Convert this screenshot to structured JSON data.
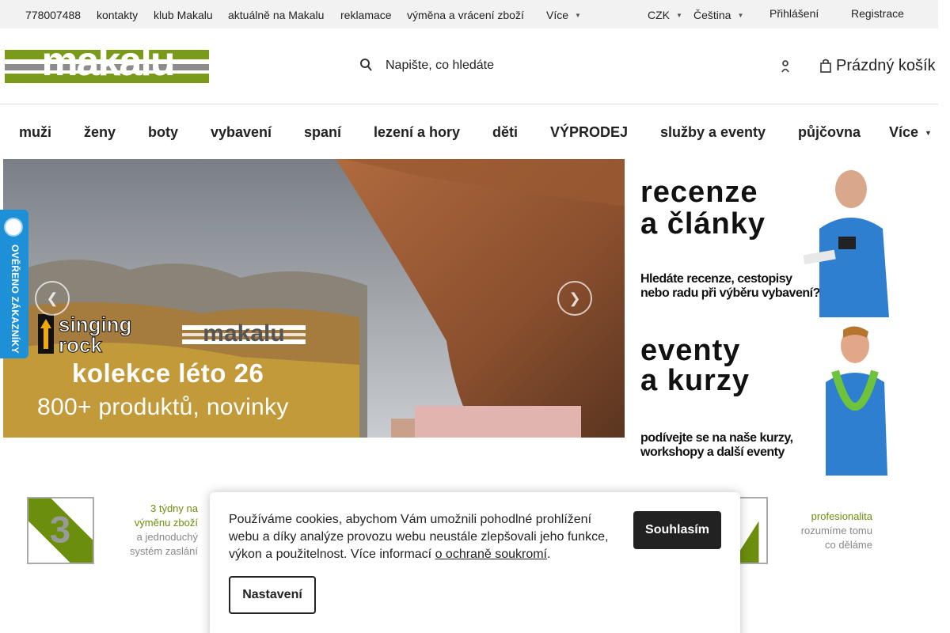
{
  "topbar": {
    "phone": "778007488",
    "links": [
      "kontakty",
      "klub Makalu",
      "aktuálně na Makalu",
      "reklamace",
      "výměna a vrácení zboží"
    ],
    "more": "Více",
    "currency": "CZK",
    "language": "Čeština",
    "login": "Přihlášení",
    "register": "Registrace"
  },
  "header": {
    "logo_text": "makalu",
    "search_placeholder": "Napište, co hledáte",
    "cart_label": "Prázdný košík"
  },
  "nav": {
    "items": [
      "muži",
      "ženy",
      "boty",
      "vybavení",
      "spaní",
      "lezení a hory",
      "děti",
      "VÝPRODEJ",
      "služby a eventy",
      "půjčovna"
    ],
    "more": "Více"
  },
  "hero": {
    "brand1": "singing rock",
    "brand2": "makalu",
    "title": "kolekce léto 26",
    "subtitle": "800+ produktů, novinky"
  },
  "side_banners": [
    {
      "title_line1": "recenze",
      "title_line2": "a články",
      "text_line1": "Hledáte recenze, cestopisy",
      "text_line2": "nebo radu při výběru vybavení?"
    },
    {
      "title_line1": "eventy",
      "title_line2": "a kurzy",
      "text_line1": "podívejte se na naše kurzy,",
      "text_line2": "workshopy a další eventy"
    }
  ],
  "badge": {
    "label": "OVĚŘENO ZÁKAZNÍKY"
  },
  "benefits": [
    {
      "line1": "3 týdny na",
      "line2": "výměnu zboží",
      "line3": "a jednoduchý",
      "line4": "systém zaslání"
    },
    {
      "line1": "profesionalita",
      "line2": "rozumíme tomu",
      "line3": "co děláme"
    }
  ],
  "cookie": {
    "text_before": "Používáme cookies, abychom Vám umožnili pohodlné prohlížení webu a díky analýze provozu webu neustále zlepšovali jeho funkce, výkon a použitelnost. Více informací ",
    "link": "o ochraně soukromí",
    "text_after": ".",
    "accept": "Souhlasím",
    "settings": "Nastavení"
  },
  "colors": {
    "brand_green": "#7a9a1a",
    "logo_gray": "#8c8c8c",
    "badge_blue": "#1e90d8"
  }
}
